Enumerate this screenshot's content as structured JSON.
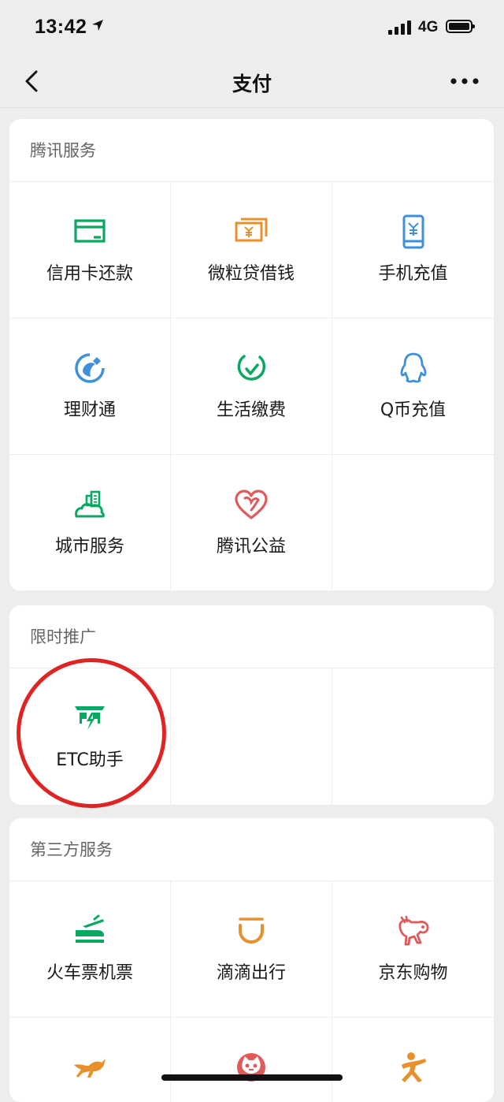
{
  "status_bar": {
    "time": "13:42",
    "network": "4G"
  },
  "nav": {
    "title": "支付"
  },
  "sections": {
    "tencent": {
      "title": "腾讯服务",
      "items": [
        {
          "label": "信用卡还款",
          "icon": "credit-card-icon",
          "color": "#07a861"
        },
        {
          "label": "微粒贷借钱",
          "icon": "loan-icon",
          "color": "#e8902b"
        },
        {
          "label": "手机充值",
          "icon": "mobile-topup-icon",
          "color": "#3f8fd9"
        },
        {
          "label": "理财通",
          "icon": "wealth-icon",
          "color": "#3f8fd9"
        },
        {
          "label": "生活缴费",
          "icon": "utilities-icon",
          "color": "#07a861"
        },
        {
          "label": "Q币充值",
          "icon": "qq-coin-icon",
          "color": "#3f8fd9"
        },
        {
          "label": "城市服务",
          "icon": "city-services-icon",
          "color": "#07a861"
        },
        {
          "label": "腾讯公益",
          "icon": "charity-heart-icon",
          "color": "#e05a5a"
        }
      ]
    },
    "promo": {
      "title": "限时推广",
      "items": [
        {
          "label": "ETC助手",
          "icon": "etc-toll-icon",
          "color": "#07a861"
        }
      ]
    },
    "third_party": {
      "title": "第三方服务",
      "items": [
        {
          "label": "火车票机票",
          "icon": "train-ticket-icon",
          "color": "#07a861"
        },
        {
          "label": "滴滴出行",
          "icon": "didi-icon",
          "color": "#e8902b"
        },
        {
          "label": "京东购物",
          "icon": "jd-dog-icon",
          "color": "#e05a5a"
        },
        {
          "label": "",
          "icon": "kangaroo-icon",
          "color": "#e8902b"
        },
        {
          "label": "",
          "icon": "cat-icon",
          "color": "#e05a5a"
        },
        {
          "label": "",
          "icon": "running-man-icon",
          "color": "#e8902b"
        }
      ]
    }
  }
}
